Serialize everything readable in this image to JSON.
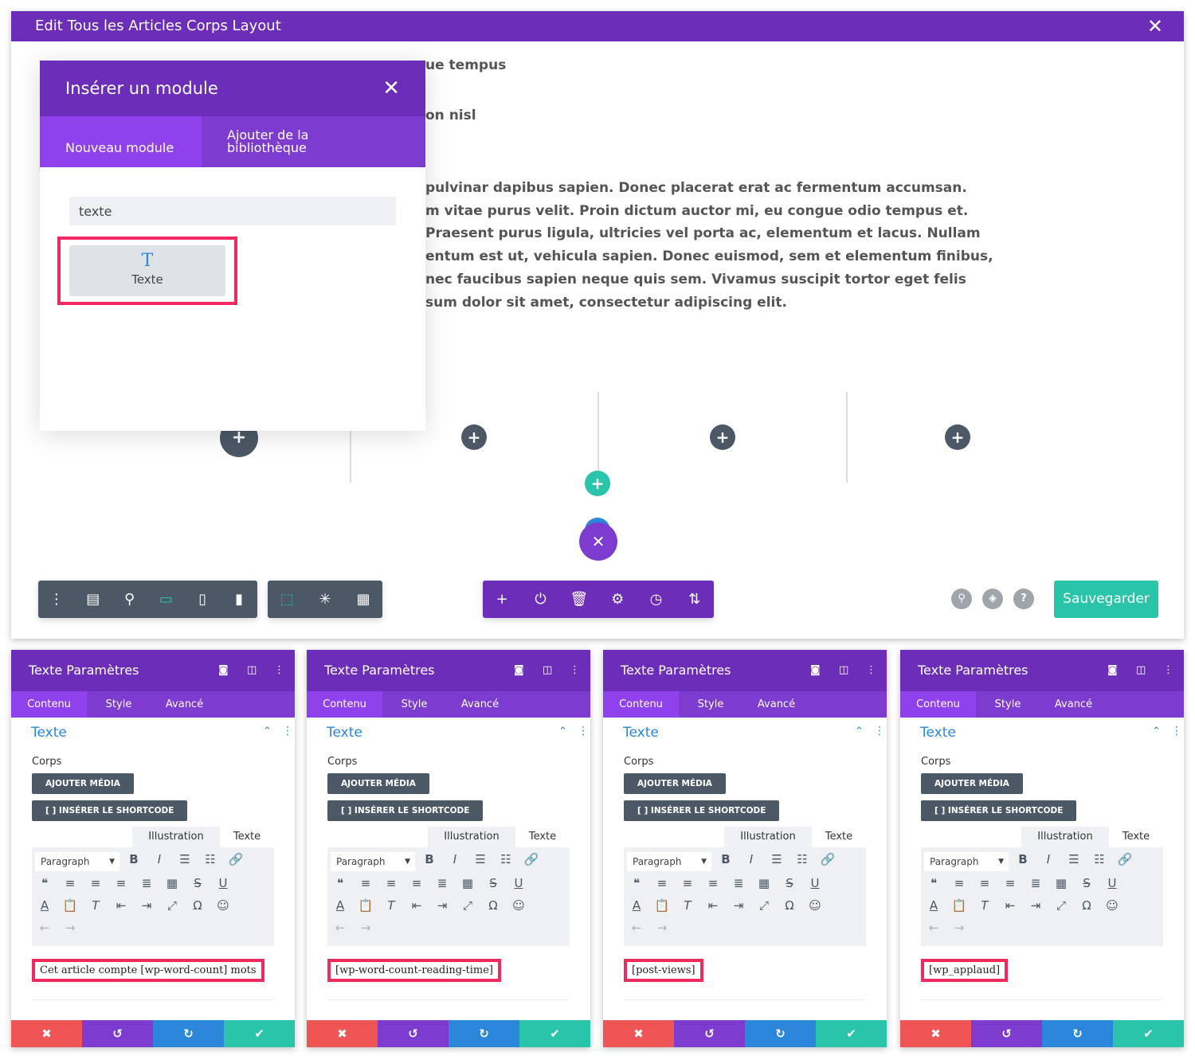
{
  "window": {
    "title": "Edit Tous les Articles Corps Layout"
  },
  "background_text": {
    "line1": "ue tempus",
    "line2": "on nisl",
    "paragraph": [
      "pulvinar dapibus sapien. Donec placerat erat ac fermentum accumsan.",
      "m vitae purus velit. Proin dictum auctor mi, eu congue odio tempus et.",
      "Praesent purus ligula, ultricies vel porta ac, elementum et lacus. Nullam",
      "entum est ut, vehicula sapien. Donec euismod, sem et elementum finibus,",
      "nec faucibus sapien neque quis sem. Vivamus suscipit tortor eget felis",
      "sum dolor sit amet, consectetur adipiscing elit."
    ]
  },
  "modal": {
    "title": "Insérer un module",
    "tabs": [
      "Nouveau module",
      "Ajouter de la bibliothèque"
    ],
    "search_value": "texte",
    "result": {
      "icon": "T",
      "label": "Texte"
    }
  },
  "toolbar": {
    "save_label": "Sauvegarder"
  },
  "colors": {
    "purple": "#6c2eb9",
    "teal": "#29c4a9",
    "dark": "#4c5866",
    "red": "#ef5555",
    "blue": "#2b87da",
    "highlight": "#ee2a5f"
  },
  "panels": [
    {
      "title": "Texte Paramètres",
      "tabs": [
        "Contenu",
        "Style",
        "Avancé"
      ],
      "section": "Texte",
      "body_label": "Corps",
      "add_media": "AJOUTER MÉDIA",
      "shortcode": "[ ] INSÉRER LE SHORTCODE",
      "editor_tabs": [
        "Illustration",
        "Texte"
      ],
      "format": "Paragraph",
      "content": "Cet article compte [wp-word-count] mots"
    },
    {
      "title": "Texte Paramètres",
      "tabs": [
        "Contenu",
        "Style",
        "Avancé"
      ],
      "section": "Texte",
      "body_label": "Corps",
      "add_media": "AJOUTER MÉDIA",
      "shortcode": "[ ] INSÉRER LE SHORTCODE",
      "editor_tabs": [
        "Illustration",
        "Texte"
      ],
      "format": "Paragraph",
      "content": "[wp-word-count-reading-time]"
    },
    {
      "title": "Texte Paramètres",
      "tabs": [
        "Contenu",
        "Style",
        "Avancé"
      ],
      "section": "Texte",
      "body_label": "Corps",
      "add_media": "AJOUTER MÉDIA",
      "shortcode": "[ ] INSÉRER LE SHORTCODE",
      "editor_tabs": [
        "Illustration",
        "Texte"
      ],
      "format": "Paragraph",
      "content": "[post-views]"
    },
    {
      "title": "Texte Paramètres",
      "tabs": [
        "Contenu",
        "Style",
        "Avancé"
      ],
      "section": "Texte",
      "body_label": "Corps",
      "add_media": "AJOUTER MÉDIA",
      "shortcode": "[ ] INSÉRER LE SHORTCODE",
      "editor_tabs": [
        "Illustration",
        "Texte"
      ],
      "format": "Paragraph",
      "content": "[wp_applaud]"
    }
  ]
}
